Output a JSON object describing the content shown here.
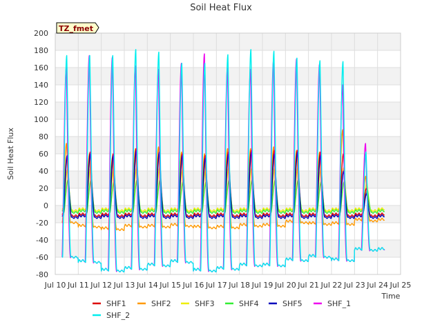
{
  "chart_data": {
    "type": "line",
    "title": "Soil Heat Flux",
    "xlabel": "Time",
    "ylabel": "Soil Heat Flux",
    "ylim": [
      -80,
      200
    ],
    "xlim": [
      10,
      25
    ],
    "grid": true,
    "legend_position": "bottom",
    "site_label": "TZ_fmet",
    "x_ticks": [
      "Jul 10",
      "Jul 11",
      "Jul 12",
      "Jul 13",
      "Jul 14",
      "Jul 15",
      "Jul 16",
      "Jul 17",
      "Jul 18",
      "Jul 19",
      "Jul 20",
      "Jul 21",
      "Jul 22",
      "Jul 23",
      "Jul 24",
      "Jul 25"
    ],
    "y_ticks": [
      "-80",
      "-60",
      "-40",
      "-20",
      "0",
      "20",
      "40",
      "60",
      "80",
      "100",
      "120",
      "140",
      "160",
      "180",
      "200"
    ],
    "x_tick_values": [
      10,
      11,
      12,
      13,
      14,
      15,
      16,
      17,
      18,
      19,
      20,
      21,
      22,
      23,
      24,
      25
    ],
    "y_tick_values": [
      -80,
      -60,
      -40,
      -20,
      0,
      20,
      40,
      60,
      80,
      100,
      120,
      140,
      160,
      180,
      200
    ],
    "series_start_day": 10.3,
    "series_end_day": 24.3,
    "day_peaks": [
      {
        "day": 10,
        "SHF1": 58,
        "SHF2": 72,
        "SHF3": 42,
        "SHF4": 30,
        "SHF5": 58,
        "SHF_1": 160,
        "SHF_2": 174,
        "night_min": -60,
        "night_shf2": -20
      },
      {
        "day": 11,
        "SHF1": 62,
        "SHF2": 60,
        "SHF3": 44,
        "SHF4": 30,
        "SHF5": 60,
        "SHF_1": 174,
        "SHF_2": 174,
        "night_min": -66,
        "night_shf2": -25
      },
      {
        "day": 12,
        "SHF1": 60,
        "SHF2": 56,
        "SHF3": 42,
        "SHF4": 28,
        "SHF5": 58,
        "SHF_1": 172,
        "SHF_2": 174,
        "night_min": -76,
        "night_shf2": -28
      },
      {
        "day": 13,
        "SHF1": 66,
        "SHF2": 66,
        "SHF3": 44,
        "SHF4": 30,
        "SHF5": 64,
        "SHF_1": 162,
        "SHF_2": 181,
        "night_min": -74,
        "night_shf2": -25
      },
      {
        "day": 14,
        "SHF1": 62,
        "SHF2": 68,
        "SHF3": 44,
        "SHF4": 30,
        "SHF5": 62,
        "SHF_1": 158,
        "SHF_2": 178,
        "night_min": -70,
        "night_shf2": -25
      },
      {
        "day": 15,
        "SHF1": 60,
        "SHF2": 62,
        "SHF3": 42,
        "SHF4": 28,
        "SHF5": 58,
        "SHF_1": 165,
        "SHF_2": 165,
        "night_min": -66,
        "night_shf2": -24
      },
      {
        "day": 16,
        "SHF1": 58,
        "SHF2": 60,
        "SHF3": 42,
        "SHF4": 28,
        "SHF5": 55,
        "SHF_1": 176,
        "SHF_2": 165,
        "night_min": -76,
        "night_shf2": -26
      },
      {
        "day": 17,
        "SHF1": 62,
        "SHF2": 66,
        "SHF3": 44,
        "SHF4": 30,
        "SHF5": 60,
        "SHF_1": 160,
        "SHF_2": 175,
        "night_min": -74,
        "night_shf2": -26
      },
      {
        "day": 18,
        "SHF1": 64,
        "SHF2": 66,
        "SHF3": 44,
        "SHF4": 30,
        "SHF5": 62,
        "SHF_1": 158,
        "SHF_2": 181,
        "night_min": -70,
        "night_shf2": -24
      },
      {
        "day": 19,
        "SHF1": 64,
        "SHF2": 68,
        "SHF3": 44,
        "SHF4": 30,
        "SHF5": 60,
        "SHF_1": 168,
        "SHF_2": 179,
        "night_min": -70,
        "night_shf2": -24
      },
      {
        "day": 20,
        "SHF1": 64,
        "SHF2": 64,
        "SHF3": 44,
        "SHF4": 30,
        "SHF5": 62,
        "SHF_1": 170,
        "SHF_2": 171,
        "night_min": -64,
        "night_shf2": -20
      },
      {
        "day": 21,
        "SHF1": 62,
        "SHF2": 62,
        "SHF3": 42,
        "SHF4": 28,
        "SHF5": 58,
        "SHF_1": 164,
        "SHF_2": 168,
        "night_min": -60,
        "night_shf2": -22
      },
      {
        "day": 22,
        "SHF1": 60,
        "SHF2": 88,
        "SHF3": 44,
        "SHF4": 28,
        "SHF5": 40,
        "SHF_1": 140,
        "SHF_2": 167,
        "night_min": -64,
        "night_shf2": -22
      },
      {
        "day": 23,
        "SHF1": 20,
        "SHF2": 34,
        "SHF3": 26,
        "SHF4": 18,
        "SHF5": 14,
        "SHF_1": 72,
        "SHF_2": 62,
        "night_min": -52,
        "night_shf2": -18
      }
    ],
    "series": [
      {
        "name": "SHF1",
        "color": "#dd0000"
      },
      {
        "name": "SHF2",
        "color": "#ff9900"
      },
      {
        "name": "SHF3",
        "color": "#eeee00"
      },
      {
        "name": "SHF4",
        "color": "#33ee33"
      },
      {
        "name": "SHF5",
        "color": "#0000bb"
      },
      {
        "name": "SHF_1",
        "color": "#ee00ee"
      },
      {
        "name": "SHF_2",
        "color": "#00eeee"
      }
    ]
  }
}
